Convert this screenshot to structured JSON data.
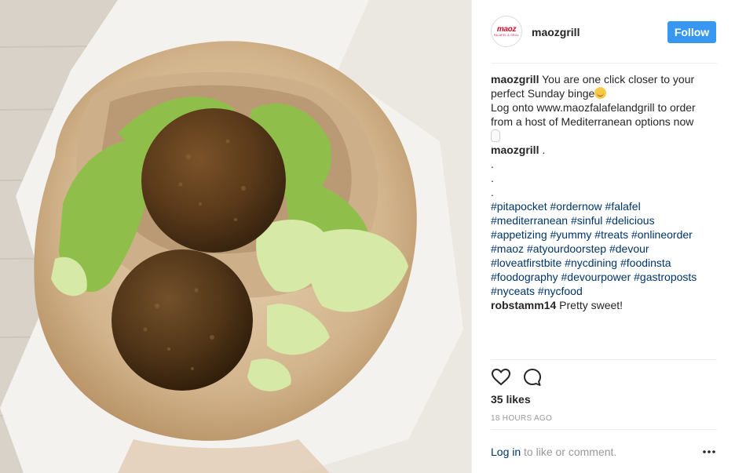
{
  "post": {
    "username": "maozgrill",
    "follow_label": "Follow",
    "avatar": {
      "logo_main": "maoz",
      "logo_sub": "FALAFEL & GRILL"
    },
    "photo": {
      "subject": "falafel-pita-photo"
    },
    "caption": {
      "user": "maozgrill",
      "line1": "You are one click closer to your perfect Sunday binge",
      "line2": "Log onto www.maozfalafelandgrill to order from a host of Mediterranean options now"
    },
    "comment2": {
      "user": "maozgrill",
      "text": ".",
      "dots": [
        ".",
        ".",
        "."
      ],
      "hashtags": [
        "#pitapocket #ordernow #falafel",
        "#mediterranean #sinful #delicious",
        "#appetizing #yummy #treats #onlineorder",
        "#maoz #atyourdoorstep #devour",
        "#loveatfirstbite #nycdining #foodinsta",
        "#foodography #devourpower #gastroposts",
        "#nyceats #nycfood"
      ]
    },
    "comment3": {
      "user": "robstamm14",
      "text": "Pretty sweet!"
    },
    "likes": "35 likes",
    "timestamp": "18 HOURS AGO",
    "login": {
      "link": "Log in",
      "rest": " to like or comment."
    }
  },
  "icons": {
    "like": "heart-icon",
    "comment": "comment-bubble-icon",
    "more": "more-options-icon"
  },
  "colors": {
    "follow": "#3897f0",
    "hashtag": "#003569",
    "brand": "#c8102e"
  }
}
